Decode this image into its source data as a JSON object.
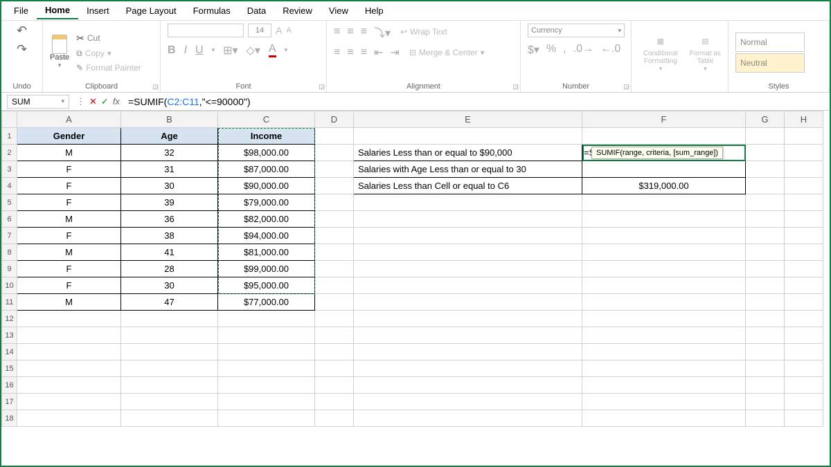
{
  "menu": [
    "File",
    "Home",
    "Insert",
    "Page Layout",
    "Formulas",
    "Data",
    "Review",
    "View",
    "Help"
  ],
  "active_menu": "Home",
  "ribbon": {
    "undo": "Undo",
    "paste": "Paste",
    "cut": "Cut",
    "copy": "Copy",
    "format_painter": "Format Painter",
    "clipboard": "Clipboard",
    "font_group": "Font",
    "font_size": "14",
    "alignment": "Alignment",
    "wrap": "Wrap Text",
    "merge": "Merge & Center",
    "number": "Number",
    "numfmt": "Currency",
    "cond": "Conditional Formatting",
    "fmttable": "Format as Table",
    "styles": "Styles",
    "style_normal": "Normal",
    "style_neutral": "Neutral"
  },
  "formula_bar": {
    "name": "SUM",
    "formula_prefix": "=SUMIF(",
    "formula_range": "C2:C11",
    "formula_suffix": ",\"<=90000\")",
    "tooltip": "SUMIF(range, criteria, [sum_range])"
  },
  "columns": [
    "A",
    "B",
    "C",
    "D",
    "E",
    "F",
    "G",
    "H"
  ],
  "headers": {
    "a": "Gender",
    "b": "Age",
    "c": "Income"
  },
  "rows": [
    {
      "a": "M",
      "b": "32",
      "c": "$98,000.00"
    },
    {
      "a": "F",
      "b": "31",
      "c": "$87,000.00"
    },
    {
      "a": "F",
      "b": "30",
      "c": "$90,000.00"
    },
    {
      "a": "F",
      "b": "39",
      "c": "$79,000.00"
    },
    {
      "a": "M",
      "b": "36",
      "c": "$82,000.00"
    },
    {
      "a": "F",
      "b": "38",
      "c": "$94,000.00"
    },
    {
      "a": "M",
      "b": "41",
      "c": "$81,000.00"
    },
    {
      "a": "F",
      "b": "28",
      "c": "$99,000.00"
    },
    {
      "a": "F",
      "b": "30",
      "c": "$95,000.00"
    },
    {
      "a": "M",
      "b": "47",
      "c": "$77,000.00"
    }
  ],
  "side": {
    "e2": "Salaries Less than  or equal to $90,000",
    "f2": "=SUMIF(C2:C11,\"<=90000\")",
    "e3": "Salaries with Age Less than or equal to 30",
    "f3": "",
    "e4": "Salaries Less than Cell  or equal to C6",
    "f4": "$319,000.00"
  }
}
